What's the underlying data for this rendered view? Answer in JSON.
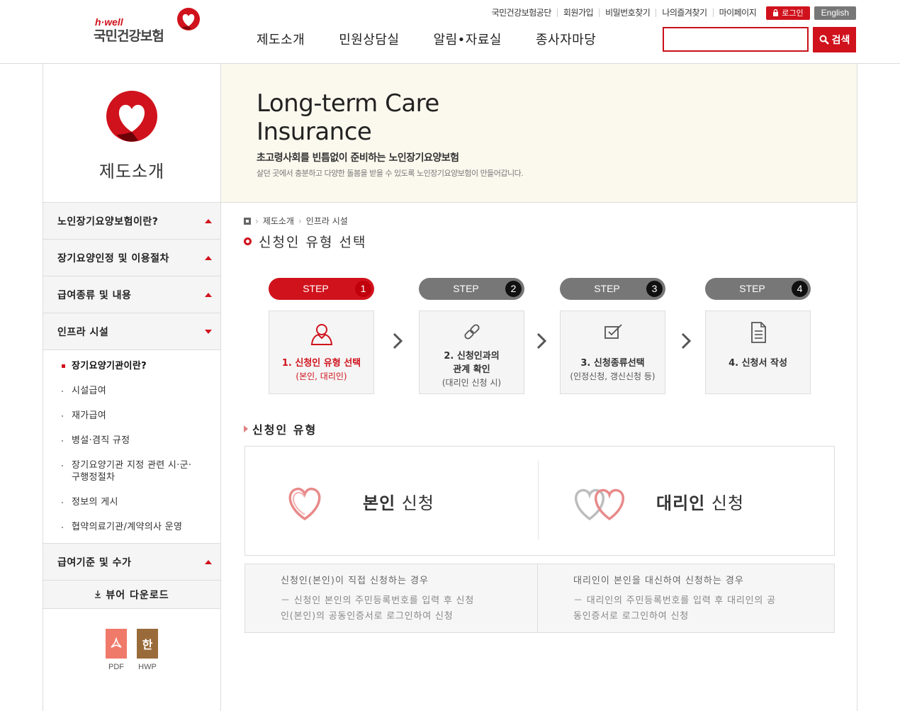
{
  "header": {
    "logo_small": "h·well",
    "logo_name": "국민건강보험",
    "util_links": [
      "국민건강보험공단",
      "회원가입",
      "비밀번호찾기",
      "나의즐겨찾기",
      "마이페이지"
    ],
    "login_label": "로그인",
    "english_label": "English",
    "gnb": [
      "제도소개",
      "민원상담실",
      "알림•자료실",
      "종사자마당"
    ],
    "search_value": "",
    "search_button": "검색"
  },
  "sidebar": {
    "title": "제도소개",
    "menus_top": [
      {
        "label": "노인장기요양보험이란?"
      },
      {
        "label": "장기요양인정 및 이용절차"
      },
      {
        "label": "급여종류 및 내용"
      },
      {
        "label": "인프라 시설"
      }
    ],
    "submenu": [
      {
        "label": "장기요양기관이란?",
        "active": true
      },
      {
        "label": "시설급여"
      },
      {
        "label": "재가급여"
      },
      {
        "label": "병설·겸직 규정"
      },
      {
        "label": "장기요양기관 지정 관련 시·군·구행정절차"
      },
      {
        "label": "정보의 게시"
      },
      {
        "label": "협약의료기관/계약의사 운영"
      }
    ],
    "menu_after": "급여기준 및 수가",
    "viewer": "뷰어 다운로드",
    "files": [
      {
        "label": "PDF"
      },
      {
        "label": "HWP",
        "glyph": "한"
      }
    ]
  },
  "banner": {
    "title_line1": "Long-term Care",
    "title_line2": "Insurance",
    "subtitle": "초고령사회를 빈틈없이 준비하는 노인장기요양보험",
    "description": "살던 곳에서 충분하고 다양한 돌봄을 받을 수 있도록 노인장기요양보험이 만들어갑니다."
  },
  "breadcrumb": [
    "제도소개",
    "인프라 시설"
  ],
  "page_title": "신청인 유형 선택",
  "steps": [
    {
      "pill": "STEP",
      "num": "1",
      "line1": "1. 신청인 유형 선택",
      "line2": "(본인, 대리인)",
      "active": true
    },
    {
      "pill": "STEP",
      "num": "2",
      "line1": "2. 신청인과의",
      "line2": "관계 확인",
      "line3": "(대리인 신청 시)"
    },
    {
      "pill": "STEP",
      "num": "3",
      "line1": "3. 신청종류선택",
      "line2": "(인정신청, 갱신신청 등)"
    },
    {
      "pill": "STEP",
      "num": "4",
      "line1": "4. 신청서 작성"
    }
  ],
  "section_title": "신청인 유형",
  "options": [
    {
      "bold": "본인",
      "rest": " 신청"
    },
    {
      "bold": "대리인",
      "rest": " 신청"
    }
  ],
  "descriptions": [
    {
      "head": "신청인(본인)이 직접 신청하는 경우",
      "line1": "－ 신청인 본인의 주민등록번호를 입력 후 신청",
      "line2": "인(본인)의 공동인증서로 로그인하여 신청"
    },
    {
      "head": "대리인이 본인을 대신하여 신청하는 경우",
      "line1": "－ 대리인의 주민등록번호를 입력 후 대리인의 공",
      "line2": "동인증서로 로그인하여 신청"
    }
  ],
  "colors": {
    "accent": "#d0121c",
    "gray_pill": "#777777"
  }
}
